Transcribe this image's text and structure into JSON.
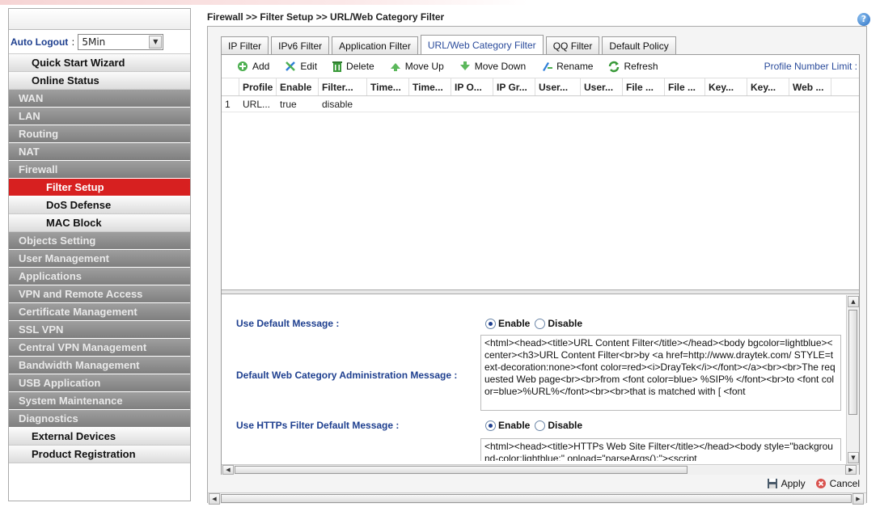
{
  "breadcrumb": "Firewall >> Filter Setup >> URL/Web Category Filter",
  "sidebar": {
    "auto_logout_label": "Auto Logout",
    "auto_logout_sep": ":",
    "auto_logout_value": "5Min",
    "items": [
      {
        "label": "Quick Start Wizard",
        "style": "light"
      },
      {
        "label": "Online Status",
        "style": "light"
      },
      {
        "label": "WAN",
        "style": "grey"
      },
      {
        "label": "LAN",
        "style": "grey"
      },
      {
        "label": "Routing",
        "style": "grey"
      },
      {
        "label": "NAT",
        "style": "grey"
      },
      {
        "label": "Firewall",
        "style": "grey"
      },
      {
        "label": "Filter Setup",
        "style": "active"
      },
      {
        "label": "DoS Defense",
        "style": "sub"
      },
      {
        "label": "MAC Block",
        "style": "sub"
      },
      {
        "label": "Objects Setting",
        "style": "grey"
      },
      {
        "label": "User Management",
        "style": "grey"
      },
      {
        "label": "Applications",
        "style": "grey"
      },
      {
        "label": "VPN and Remote Access",
        "style": "grey"
      },
      {
        "label": "Certificate Management",
        "style": "grey"
      },
      {
        "label": "SSL VPN",
        "style": "grey"
      },
      {
        "label": "Central VPN Management",
        "style": "grey"
      },
      {
        "label": "Bandwidth Management",
        "style": "grey"
      },
      {
        "label": "USB Application",
        "style": "grey"
      },
      {
        "label": "System Maintenance",
        "style": "grey"
      },
      {
        "label": "Diagnostics",
        "style": "grey"
      },
      {
        "label": "External Devices",
        "style": "light"
      },
      {
        "label": "Product Registration",
        "style": "light"
      }
    ]
  },
  "tabs": [
    "IP Filter",
    "IPv6 Filter",
    "Application Filter",
    "URL/Web Category Filter",
    "QQ Filter",
    "Default Policy"
  ],
  "active_tab": "URL/Web Category Filter",
  "toolbar": {
    "add": "Add",
    "edit": "Edit",
    "delete": "Delete",
    "move_up": "Move Up",
    "move_down": "Move Down",
    "rename": "Rename",
    "refresh": "Refresh",
    "profile_limit": "Profile Number Limit :"
  },
  "grid": {
    "columns": [
      "Profile",
      "Enable",
      "Filter...",
      "Time...",
      "Time...",
      "IP O...",
      "IP Gr...",
      "User...",
      "User...",
      "File ...",
      "File ...",
      "Key...",
      "Key...",
      "Web ..."
    ],
    "rows": [
      {
        "index": "1",
        "cells": [
          "URL...",
          "true",
          "disable",
          "",
          "",
          "",
          "",
          "",
          "",
          "",
          "",
          "",
          "",
          ""
        ]
      }
    ]
  },
  "form": {
    "use_default_message_label": "Use Default Message",
    "use_default_message_value": "Enable",
    "enable_label": "Enable",
    "disable_label": "Disable",
    "default_admin_message_label": "Default Web Category Administration Message",
    "default_admin_message_text": "<html><head><title>URL Content Filter</title></head><body bgcolor=lightblue><center><h3>URL Content Filter<br>by <a href=http://www.draytek.com/ STYLE=text-decoration:none><font color=red><i>DrayTek</i></font></a><br><br>The requested Web page<br><br>from <font color=blue> %SIP% </font><br>to <font color=blue>%URL%</font><br><br>that is matched with [ <font",
    "use_https_label": "Use HTTPs Filter Default Message",
    "use_https_value": "Enable",
    "https_message_text": "<html><head><title>HTTPs Web Site Filter</title></head><body style=\"background-color:lightblue;\" onload=\"parseArgs();\"><script"
  },
  "actions": {
    "apply": "Apply",
    "cancel": "Cancel"
  }
}
